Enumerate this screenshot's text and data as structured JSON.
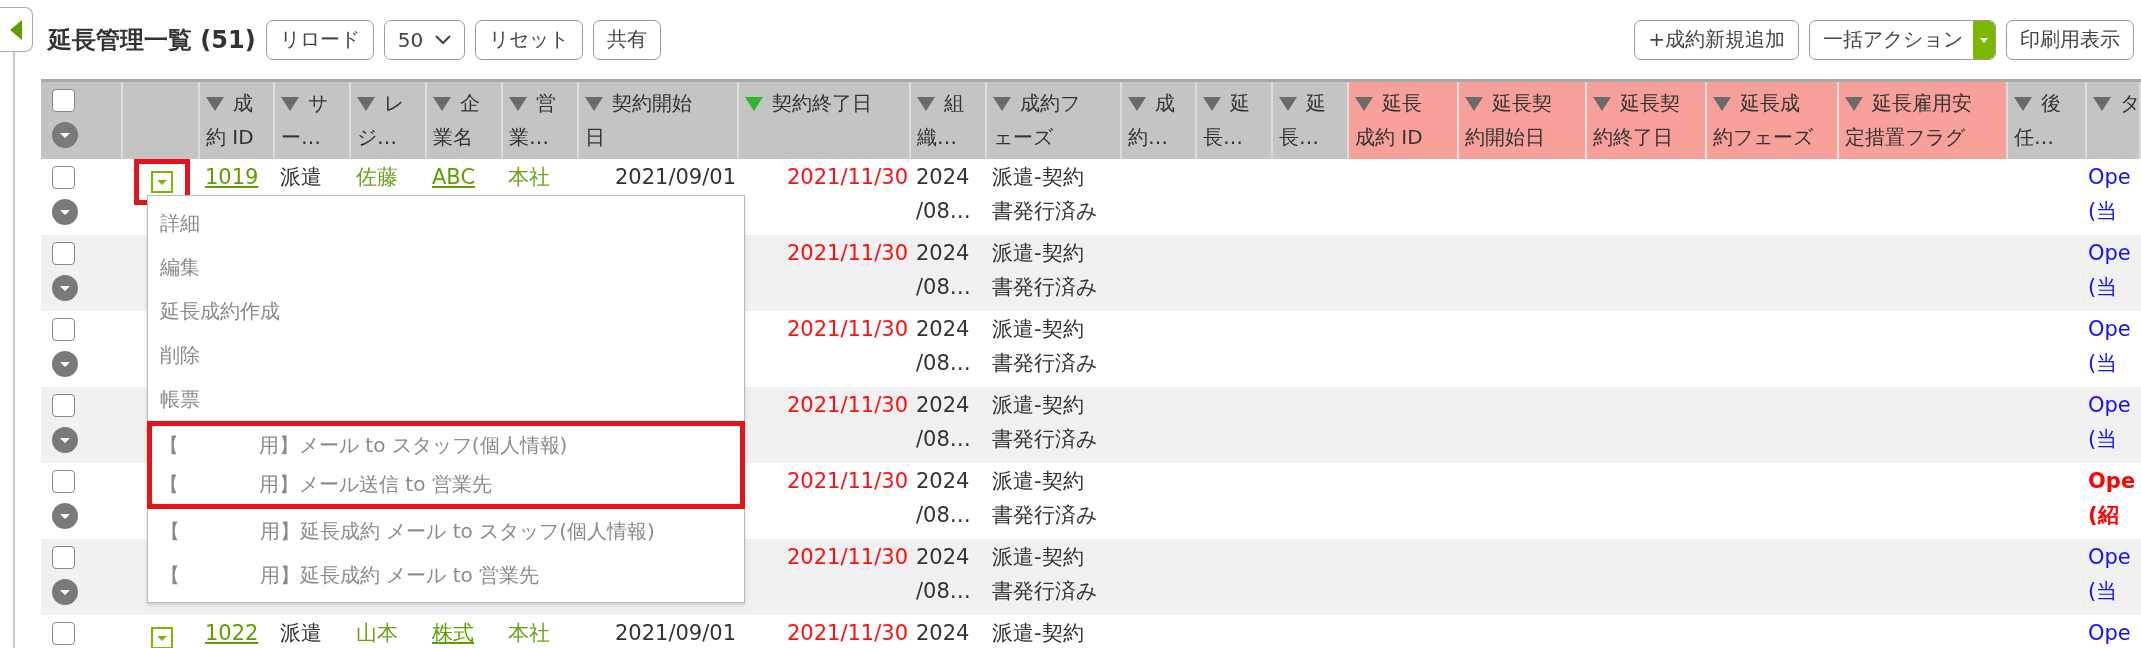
{
  "page": {
    "title": "延長管理一覧 (51)"
  },
  "toolbar": {
    "left": [
      {
        "kind": "button",
        "label": "リロード"
      },
      {
        "kind": "select",
        "label": "50"
      },
      {
        "kind": "button",
        "label": "リセット"
      },
      {
        "kind": "button",
        "label": "共有"
      }
    ],
    "right": [
      {
        "kind": "button",
        "label": "+成約新規追加"
      },
      {
        "kind": "split",
        "label": "一括アクション"
      },
      {
        "kind": "button",
        "label": "印刷用表示"
      }
    ]
  },
  "table": {
    "header_checkbox": {
      "checked": false
    },
    "columns": [
      {
        "label": "成約 ID",
        "kind": "link",
        "sorted": false,
        "highlighted": false
      },
      {
        "label": "サー…",
        "kind": "text",
        "sorted": false,
        "highlighted": false
      },
      {
        "label": "レジ…",
        "kind": "green",
        "sorted": false,
        "highlighted": false
      },
      {
        "label": "企業名",
        "kind": "link",
        "sorted": false,
        "highlighted": false
      },
      {
        "label": "営業…",
        "kind": "green",
        "sorted": false,
        "highlighted": false
      },
      {
        "label": "契約開始日",
        "kind": "date",
        "sorted": false,
        "highlighted": false
      },
      {
        "label": "契約終了日",
        "kind": "due",
        "sorted": true,
        "highlighted": false
      },
      {
        "label": "組織…",
        "kind": "text",
        "sorted": false,
        "highlighted": false
      },
      {
        "label": "成約フェーズ",
        "kind": "text",
        "sorted": false,
        "highlighted": false
      },
      {
        "label": "成約…",
        "kind": "text",
        "sorted": false,
        "highlighted": false
      },
      {
        "label": "延長…",
        "kind": "text",
        "sorted": false,
        "highlighted": false
      },
      {
        "label": "延長…",
        "kind": "text",
        "sorted": false,
        "highlighted": false
      },
      {
        "label": "延長成約 ID",
        "kind": "text",
        "sorted": false,
        "highlighted": true
      },
      {
        "label": "延長契約開始日",
        "kind": "text",
        "sorted": false,
        "highlighted": true
      },
      {
        "label": "延長契約終了日",
        "kind": "text",
        "sorted": false,
        "highlighted": true
      },
      {
        "label": "延長成約フェーズ",
        "kind": "text",
        "sorted": false,
        "highlighted": true
      },
      {
        "label": "延長雇用安定措置フラグ",
        "kind": "text",
        "sorted": false,
        "highlighted": true
      },
      {
        "label": "後任…",
        "kind": "text",
        "sorted": false,
        "highlighted": false
      },
      {
        "label": "タ",
        "kind": "status",
        "sorted": false,
        "highlighted": false
      }
    ],
    "rows": [
      {
        "checked": false,
        "alert": false,
        "action": {
          "annotated": true
        },
        "cells": [
          "1019",
          "派遣",
          "佐藤",
          "ABC",
          "本社",
          "2021/09/01",
          "2021/11/30",
          "2024/08…",
          "派遣-契約書発行済み",
          null,
          null,
          null,
          null,
          null,
          null,
          null,
          null,
          null,
          "Ope(当"
        ]
      },
      {
        "checked": false,
        "alert": false,
        "cells": [
          null,
          null,
          null,
          null,
          null,
          null,
          "2021/11/30",
          "2024/08…",
          "派遣-契約書発行済み",
          null,
          null,
          null,
          null,
          null,
          null,
          null,
          null,
          null,
          "Ope(当"
        ]
      },
      {
        "checked": false,
        "alert": false,
        "cells": [
          null,
          null,
          null,
          null,
          null,
          null,
          "2021/11/30",
          "2024/08…",
          "派遣-契約書発行済み",
          null,
          null,
          null,
          null,
          null,
          null,
          null,
          null,
          null,
          "Ope(当"
        ]
      },
      {
        "checked": false,
        "alert": false,
        "cells": [
          null,
          null,
          null,
          null,
          null,
          null,
          "2021/11/30",
          "2024/08…",
          "派遣-契約書発行済み",
          null,
          null,
          null,
          null,
          null,
          null,
          null,
          null,
          null,
          "Ope(当"
        ]
      },
      {
        "checked": false,
        "alert": true,
        "cells": [
          null,
          null,
          null,
          null,
          null,
          null,
          "2021/11/30",
          "2024/08…",
          "派遣-契約書発行済み",
          null,
          null,
          null,
          null,
          null,
          null,
          null,
          null,
          null,
          "Ope(紹"
        ]
      },
      {
        "checked": false,
        "alert": false,
        "cells": [
          null,
          null,
          null,
          null,
          null,
          null,
          "2021/11/30",
          "2024/08…",
          "派遣-契約書発行済み",
          null,
          null,
          null,
          null,
          null,
          null,
          null,
          null,
          null,
          "Ope(当"
        ]
      },
      {
        "checked": false,
        "alert": false,
        "menu_button": false,
        "action": {
          "annotated": false
        },
        "cells": [
          "1022",
          "派遣",
          "山本",
          "株式",
          "本社",
          "2021/09/01",
          "2021/11/30",
          "2024",
          "派遣-契約",
          null,
          null,
          null,
          null,
          null,
          null,
          null,
          null,
          null,
          "Ope"
        ]
      }
    ]
  },
  "row_menu": {
    "items": [
      {
        "label": "詳細",
        "annotated": false
      },
      {
        "label": "編集",
        "annotated": false
      },
      {
        "label": "延長成約作成",
        "annotated": false
      },
      {
        "label": "削除",
        "annotated": false
      },
      {
        "label": "帳票",
        "annotated": false
      },
      {
        "label": "【　　　　用】メール to スタッフ(個人情報)",
        "annotated": true
      },
      {
        "label": "【　　　　用】メール送信 to 営業先",
        "annotated": true
      },
      {
        "label": "【　　　　用】延長成約 メール to スタッフ(個人情報)",
        "annotated": false
      },
      {
        "label": "【　　　　用】延長成約 メール to 営業先",
        "annotated": false
      }
    ]
  }
}
